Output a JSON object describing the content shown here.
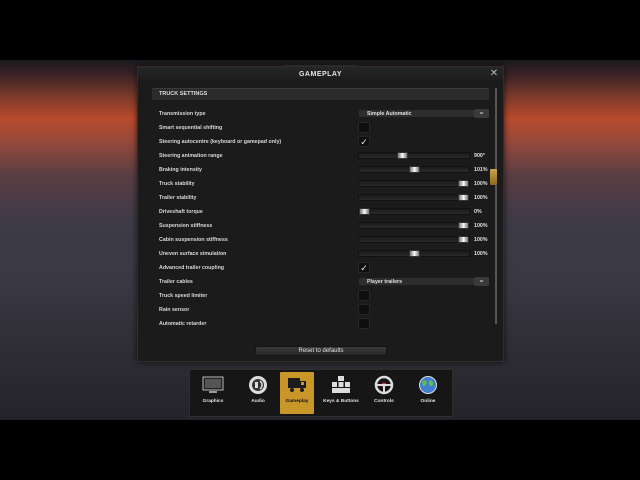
{
  "dialog": {
    "title": "GAMEPLAY",
    "close_label": "✕",
    "section_header": "TRUCK SETTINGS",
    "reset_label": "Reset to defaults"
  },
  "settings": [
    {
      "label": "Transmission type",
      "kind": "dropdown",
      "value": "Simple Automatic"
    },
    {
      "label": "Smart sequential shifting",
      "kind": "checkbox",
      "checked": false
    },
    {
      "label": "Steering autocentre (keyboard or gamepad only)",
      "kind": "checkbox",
      "checked": true
    },
    {
      "label": "Steering animation range",
      "kind": "slider",
      "value": "900°",
      "fraction": 0.38
    },
    {
      "label": "Braking intensity",
      "kind": "slider",
      "value": "101%",
      "fraction": 0.5
    },
    {
      "label": "Truck stability",
      "kind": "slider",
      "value": "100%",
      "fraction": 1.0
    },
    {
      "label": "Trailer stability",
      "kind": "slider",
      "value": "100%",
      "fraction": 1.0
    },
    {
      "label": "Driveshaft torque",
      "kind": "slider",
      "value": "0%",
      "fraction": 0.0
    },
    {
      "label": "Suspension stiffness",
      "kind": "slider",
      "value": "100%",
      "fraction": 1.0
    },
    {
      "label": "Cabin suspension stiffness",
      "kind": "slider",
      "value": "100%",
      "fraction": 1.0
    },
    {
      "label": "Uneven surface simulation",
      "kind": "slider",
      "value": "100%",
      "fraction": 0.5
    },
    {
      "label": "Advanced trailer coupling",
      "kind": "checkbox",
      "checked": true
    },
    {
      "label": "Trailer cables",
      "kind": "dropdown",
      "value": "Player trailers"
    },
    {
      "label": "Truck speed limiter",
      "kind": "checkbox",
      "checked": false
    },
    {
      "label": "Rain sensor",
      "kind": "checkbox",
      "checked": false
    },
    {
      "label": "Automatic retarder",
      "kind": "checkbox",
      "checked": false
    }
  ],
  "nav": [
    {
      "label": "Graphics",
      "icon": "monitor-icon",
      "active": false
    },
    {
      "label": "Audio",
      "icon": "speaker-icon",
      "active": false
    },
    {
      "label": "Gameplay",
      "icon": "truck-icon",
      "active": true
    },
    {
      "label": "Keys & Buttons",
      "icon": "keyboard-icon",
      "active": false
    },
    {
      "label": "Controls",
      "icon": "steering-wheel-icon",
      "active": false
    },
    {
      "label": "Online",
      "icon": "globe-icon",
      "active": false
    }
  ],
  "colors": {
    "accent": "#c9962a",
    "panel": "#1b1b1b"
  }
}
